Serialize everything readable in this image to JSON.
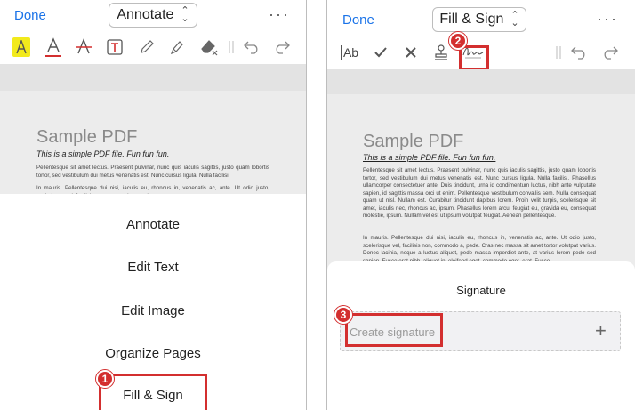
{
  "left_panel": {
    "done_label": "Done",
    "mode_label": "Annotate",
    "more_label": "···",
    "toolbar_icons": [
      "highlight-icon",
      "text-color-icon",
      "strikethrough-icon",
      "text-box-icon",
      "pencil-icon",
      "marker-icon",
      "eraser-icon",
      "undo-icon",
      "redo-icon"
    ],
    "document": {
      "title": "Sample PDF",
      "subtitle": "This is a simple PDF file. Fun fun fun.",
      "paragraph1": "Pellentesque sit amet lectus. Praesent pulvinar, nunc quis iaculis sagittis, justo quam lobortis tortor, sed vestibulum dui metus venenatis est. Nunc cursus ligula. Nulla facilisi.",
      "paragraph2": "In mauris. Pellentesque dui nisi, iaculis eu, rhoncus in, venenatis ac, ante. Ut odio justo, scelerisque vel, facilisis non, commodo a, pede."
    },
    "menu": [
      "Annotate",
      "Edit Text",
      "Edit Image",
      "Organize Pages",
      "Fill & Sign"
    ],
    "badge": "1"
  },
  "right_panel": {
    "done_label": "Done",
    "mode_label": "Fill & Sign",
    "more_label": "···",
    "toolbar_icons": [
      "text-field-icon",
      "checkmark-icon",
      "cross-icon",
      "stamp-icon",
      "signature-icon",
      "undo-icon",
      "redo-icon"
    ],
    "text_tool_label": "Ab",
    "document": {
      "title": "Sample PDF",
      "subtitle": "This is a simple PDF file. Fun fun fun.",
      "paragraph1": "Pellentesque sit amet lectus. Praesent pulvinar, nunc quis iaculis sagittis, justo quam lobortis tortor, sed vestibulum dui metus venenatis est. Nunc cursus ligula. Nulla facilisi. Phasellus ullamcorper consectetuer ante. Duis tincidunt, urna id condimentum luctus, nibh ante vulputate sapien, id sagittis massa orci ut enim. Pellentesque vestibulum convallis sem. Nulla consequat quam ut nisl. Nullam est. Curabitur tincidunt dapibus lorem. Proin velit turpis, scelerisque sit amet, iaculis nec, rhoncus ac, ipsum. Phasellus lorem arcu, feugiat eu, gravida eu, consequat molestie, ipsum. Nullam vel est ut ipsum volutpat feugiat. Aenean pellentesque.",
      "paragraph2": "In mauris. Pellentesque dui nisi, iaculis eu, rhoncus in, venenatis ac, ante. Ut odio justo, scelerisque vel, facilisis non, commodo a, pede. Cras nec massa sit amet tortor volutpat varius. Donec lacinia, neque a luctus aliquet, pede massa imperdiet ante, at varius lorem pede sed sapien. Fusce erat nibh, aliquet in, eleifend eget, commodo eget, erat. Fusce"
    },
    "signature": {
      "title": "Signature",
      "placeholder": "Create signature",
      "add_label": "+"
    },
    "badge_toolbar": "2",
    "badge_signature": "3"
  },
  "colors": {
    "accent": "#1a73e8",
    "callout": "#d32f2f",
    "highlight": "#f2ea1c"
  }
}
